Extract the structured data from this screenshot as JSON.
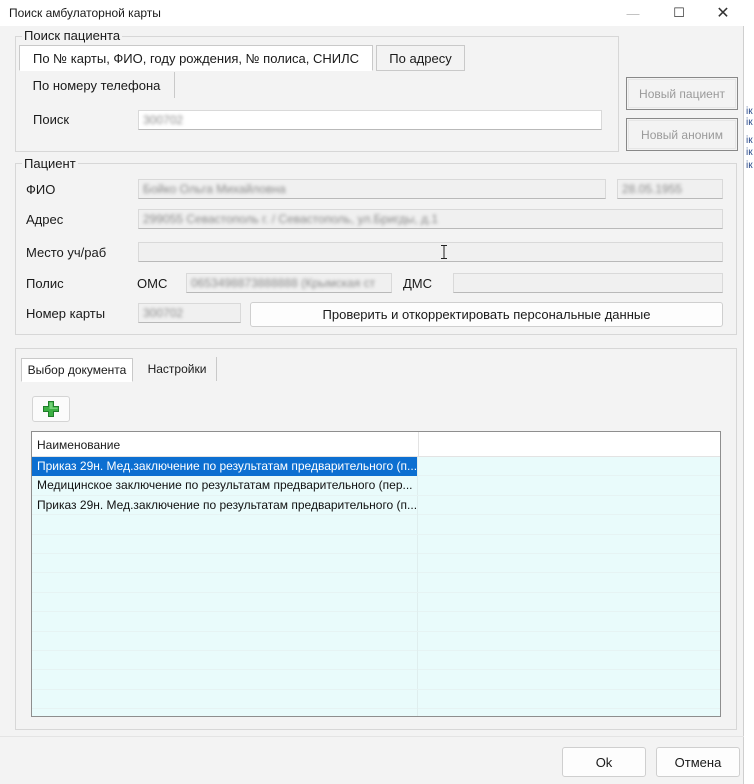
{
  "window": {
    "title": "Поиск амбулаторной карты",
    "controls": {
      "minimize": "—",
      "maximize": "☐",
      "close": "✕"
    }
  },
  "search": {
    "group_label": "Поиск пациента",
    "tabs": [
      {
        "label": "По № карты, ФИО, году рождения, № полиса, СНИЛС",
        "active": true
      },
      {
        "label": "По адресу",
        "active": false
      },
      {
        "label": "По номеру телефона",
        "active": false
      }
    ],
    "search_label": "Поиск",
    "search_value": "300702"
  },
  "side_buttons": {
    "new_patient": "Новый пациент",
    "new_anonymous": "Новый аноним"
  },
  "patient": {
    "group_label": "Пациент",
    "fio_label": "ФИО",
    "fio_value": "Бойко Ольга Михайловна",
    "birth_value": "28.05.1955",
    "address_label": "Адрес",
    "address_value": "299055 Севастополь г. / Севастополь, ул.Бригды, д.1",
    "work_label": "Место уч/раб",
    "work_value": "",
    "policy_label": "Полис",
    "oms_label": "ОМС",
    "oms_value": "0653498873888888 (Крымская ст",
    "dms_label": "ДМС",
    "dms_value": "",
    "card_label": "Номер карты",
    "card_value": "300702",
    "verify_button": "Проверить и откорректировать персональные данные"
  },
  "documents": {
    "tabs": [
      {
        "label": "Выбор документа",
        "active": true
      },
      {
        "label": "Настройки",
        "active": false
      }
    ],
    "add_icon": "plus-icon",
    "column_header": "Наименование",
    "rows": [
      {
        "name": "Приказ 29н. Мед.заключение по результатам предварительного (п...",
        "selected": true
      },
      {
        "name": "Медицинское заключение по результатам предварительного (пер...",
        "selected": false
      },
      {
        "name": "Приказ 29н. Мед.заключение по результатам предварительного (п...",
        "selected": false
      },
      {
        "name": "",
        "selected": false
      },
      {
        "name": "",
        "selected": false
      },
      {
        "name": "",
        "selected": false
      },
      {
        "name": "",
        "selected": false
      },
      {
        "name": "",
        "selected": false
      },
      {
        "name": "",
        "selected": false
      },
      {
        "name": "",
        "selected": false
      },
      {
        "name": "",
        "selected": false
      },
      {
        "name": "",
        "selected": false
      },
      {
        "name": "",
        "selected": false
      },
      {
        "name": "",
        "selected": false
      }
    ]
  },
  "footer": {
    "ok_button": "Ok",
    "cancel_button": "Отмена"
  },
  "background_window": {
    "fragments": [
      "iк",
      "iк",
      "iк",
      "iк",
      "iк"
    ]
  },
  "colors": {
    "selection": "#0c6fd1",
    "row_background": "#e9fbfb",
    "add_icon_green": "#3cb043"
  }
}
